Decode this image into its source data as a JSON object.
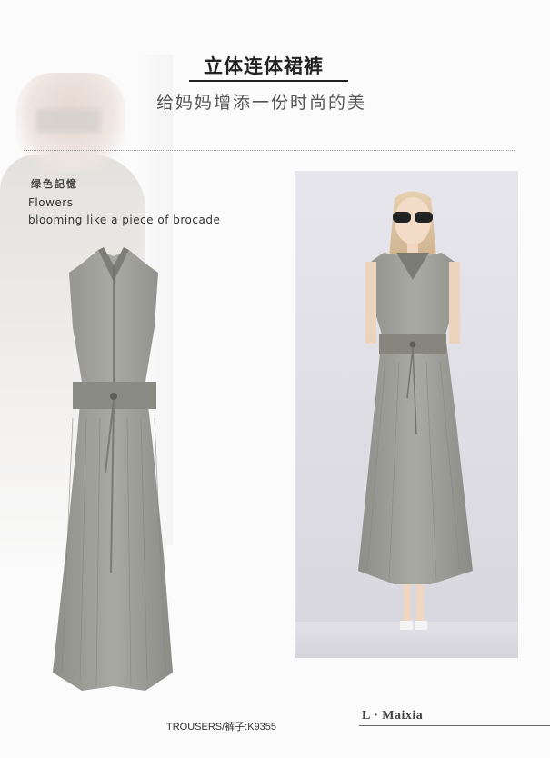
{
  "header": {
    "title": "立体连体裙裤",
    "subtitle": "给妈妈增添一份时尚的美"
  },
  "tagline": {
    "cn": "绿色記憶",
    "en_line1": "Flowers",
    "en_line2": "blooming like a piece of brocade"
  },
  "product": {
    "code": "TROUSERS/裤子:K9355"
  },
  "brand": {
    "name": "L · Maixia"
  },
  "colors": {
    "fabric": "#9b9b96",
    "background": "#fbfbfb",
    "photo_bg": "#e4e3e9"
  }
}
